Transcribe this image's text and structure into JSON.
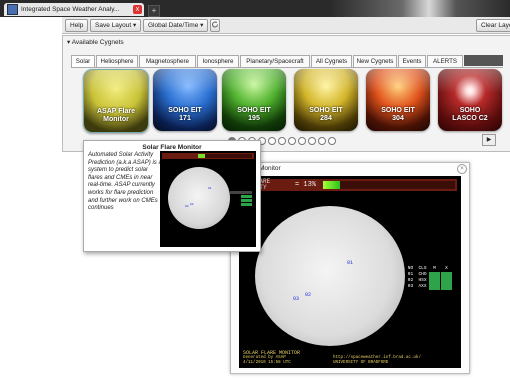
{
  "browser": {
    "tab_title": "Integrated Space Weather Analy...",
    "close_glyph": "x",
    "new_tab_glyph": "+"
  },
  "toolbar": {
    "help": "Help",
    "save_layout": "Save Layout ▾",
    "global_datetime": "Global Date/Time ▾",
    "refresh_icon": "refresh-icon",
    "clear_layout": "Clear Layou"
  },
  "panel": {
    "header": "▾ Available Cygnets",
    "tabs": [
      "Solar",
      "Heliosphere",
      "Magnetosphere",
      "Ionosphere",
      "Planetary/Spacecraft",
      "All Cygnets",
      "New Cygnets",
      "Events",
      "ALERTS"
    ],
    "active_tab": "Solar",
    "cygnets": [
      {
        "line1": "ASAP Flare",
        "line2": "Monitor",
        "color": "#c8c238"
      },
      {
        "line1": "SOHO EIT",
        "line2": "171",
        "color": "#2a6fd0"
      },
      {
        "line1": "SOHO EIT",
        "line2": "195",
        "color": "#4fb12e"
      },
      {
        "line1": "SOHO EIT",
        "line2": "284",
        "color": "#d2b52a"
      },
      {
        "line1": "SOHO EIT",
        "line2": "304",
        "color": "#e0531c"
      },
      {
        "line1": "SOHO",
        "line2": "LASCO C2",
        "color": "#b82a2a"
      }
    ],
    "page_count": 11,
    "current_page": 1,
    "next_glyph": "▶"
  },
  "monitor": {
    "title": "Monitor",
    "close_glyph": "×",
    "prob_label_1": "R FLARE",
    "prob_label_2": "BILITY",
    "prob_value": "= 13%",
    "prob_fraction": 0.13,
    "regions": [
      "01",
      "02",
      "03"
    ],
    "table": [
      [
        "NO",
        "CLS",
        "M",
        "X"
      ],
      [
        "01",
        "CHO",
        "",
        ""
      ],
      [
        "02",
        "HSX",
        "",
        ""
      ],
      [
        "03",
        "AXX",
        "",
        ""
      ]
    ],
    "footer": {
      "title": "SOLAR FLARE MONITOR",
      "generated": "Generated by ASAP",
      "datetime": "4/11/2010 15:58 UTC",
      "url": "http://spaceweather.inf.brad.ac.uk/",
      "org": "UNIVERSITY OF BRADFORD"
    }
  },
  "tooltip": {
    "title": "Solar Flare Monitor",
    "description": "Automated Solar Activity Prediction (a.k.a ASAP) is a system to predict solar flares and CMEs in near real-time. ASAP currently works for flare prediction and further work on CMEs continues",
    "regions": [
      "01",
      "02",
      "03"
    ]
  }
}
